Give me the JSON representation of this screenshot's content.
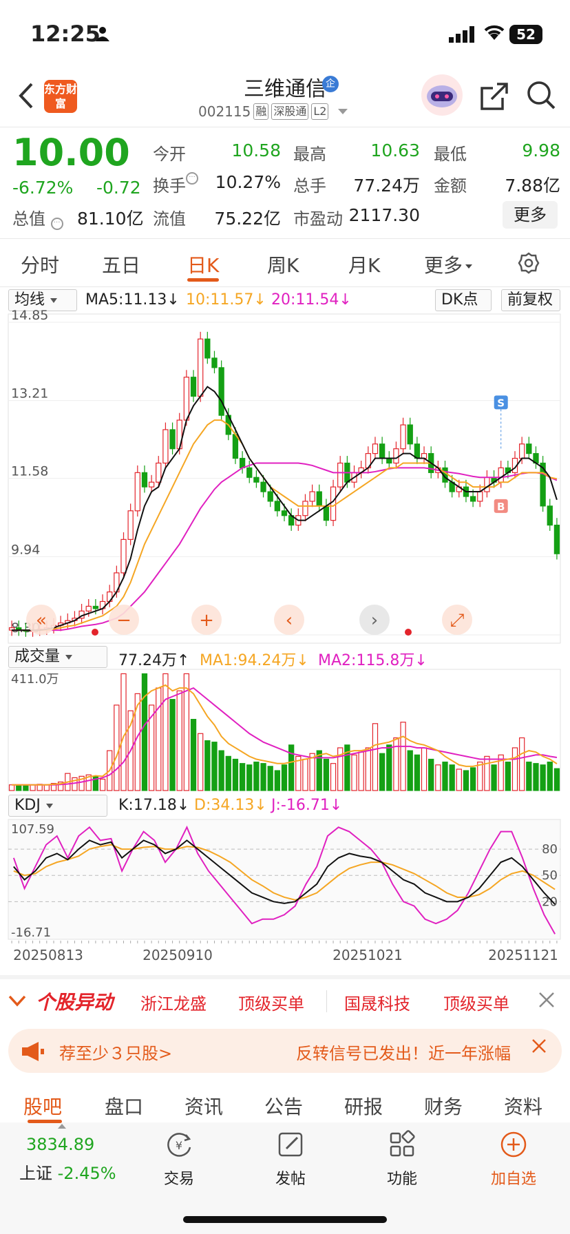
{
  "status": {
    "time": "12:25",
    "battery": "52"
  },
  "header": {
    "logo": "东方财富",
    "name": "三维通信",
    "badge": "企",
    "code": "002115",
    "tags": [
      "融",
      "深股通",
      "L2"
    ]
  },
  "quote": {
    "price": "10.00",
    "pct": "-6.72%",
    "chg": "-0.72",
    "cap_label": "总值",
    "cap_value": "81.10亿",
    "fields": [
      {
        "label": "今开",
        "value": "10.58",
        "color": "green"
      },
      {
        "label": "最高",
        "value": "10.63",
        "color": "green"
      },
      {
        "label": "最低",
        "value": "9.98",
        "color": "green"
      },
      {
        "label": "换手",
        "value": "10.27%",
        "color": "plain"
      },
      {
        "label": "总手",
        "value": "77.24万",
        "color": "plain"
      },
      {
        "label": "金额",
        "value": "7.88亿",
        "color": "plain"
      },
      {
        "label": "流值",
        "value": "75.22亿",
        "color": "plain"
      },
      {
        "label": "市盈动",
        "value": "2117.30",
        "color": "plain"
      }
    ],
    "more": "更多"
  },
  "ktabs": [
    "分时",
    "五日",
    "日K",
    "周K",
    "月K",
    "更多"
  ],
  "chart_legend": {
    "ma_selector": "均线",
    "ma5": "MA5:11.13↓",
    "ma10": "10:11.57↓",
    "ma20": "20:11.54↓",
    "dk": "DK点",
    "fq": "前复权",
    "vol_selector": "成交量",
    "vol": "77.24万↑",
    "vol_ma1": "MA1:94.24万↓",
    "vol_ma2": "MA2:115.8万↓",
    "kdj_selector": "KDJ",
    "k": "K:17.18↓",
    "d": "D:34.13↓",
    "j": "J:-16.71↓"
  },
  "chart_data": {
    "type": "candlestick",
    "y_ticks": [
      "14.85",
      "13.21",
      "11.58",
      "9.94",
      "8.30"
    ],
    "ylim": [
      8.3,
      14.85
    ],
    "vol_max_label": "411.0万",
    "kdj_ticks": {
      "top": "107.59",
      "bottom": "-16.71",
      "levels": [
        "80",
        "50",
        "20"
      ]
    },
    "x_ticks": [
      "20250813",
      "20250910",
      "20251021",
      "20251121"
    ],
    "signals": [
      "S",
      "B"
    ],
    "colors": {
      "up": "#e3242b",
      "down": "#14a014",
      "ma5": "#111111",
      "ma10": "#f5a623",
      "ma20": "#e020c0",
      "k": "#111111",
      "d": "#f5a623",
      "j": "#e020c0"
    },
    "close": [
      8.45,
      8.4,
      8.38,
      8.4,
      8.42,
      8.45,
      8.5,
      8.55,
      8.6,
      8.65,
      8.8,
      8.9,
      8.85,
      9.0,
      9.2,
      9.6,
      10.3,
      10.9,
      11.7,
      11.4,
      11.5,
      11.9,
      12.6,
      12.2,
      12.8,
      13.7,
      13.3,
      14.5,
      14.1,
      13.9,
      12.9,
      12.5,
      12.0,
      11.8,
      11.6,
      11.5,
      11.3,
      11.1,
      10.9,
      10.8,
      10.6,
      10.8,
      11.1,
      11.3,
      11.0,
      10.7,
      11.4,
      11.9,
      11.5,
      11.7,
      11.8,
      12.1,
      12.3,
      12.0,
      11.9,
      12.2,
      12.7,
      12.3,
      12.0,
      12.1,
      11.7,
      11.8,
      11.5,
      11.3,
      11.4,
      11.2,
      11.1,
      11.3,
      11.6,
      11.5,
      11.8,
      11.7,
      12.0,
      12.3,
      12.1,
      11.9,
      11.0,
      10.6,
      10.0
    ],
    "open": [
      8.4,
      8.45,
      8.4,
      8.38,
      8.4,
      8.42,
      8.45,
      8.5,
      8.55,
      8.6,
      8.65,
      8.8,
      8.9,
      8.85,
      9.0,
      9.2,
      9.6,
      10.3,
      10.9,
      11.7,
      11.4,
      11.5,
      11.9,
      12.6,
      12.2,
      12.8,
      13.7,
      13.3,
      14.5,
      14.1,
      13.9,
      12.9,
      12.5,
      12.0,
      11.8,
      11.6,
      11.5,
      11.3,
      11.1,
      10.9,
      10.8,
      10.6,
      10.8,
      11.1,
      11.3,
      11.0,
      10.7,
      11.4,
      11.9,
      11.5,
      11.7,
      11.8,
      12.1,
      12.3,
      12.0,
      11.9,
      12.2,
      12.7,
      12.3,
      12.0,
      12.1,
      11.7,
      11.8,
      11.5,
      11.3,
      11.4,
      11.2,
      11.1,
      11.3,
      11.6,
      11.5,
      11.8,
      11.7,
      12.0,
      12.3,
      12.1,
      11.9,
      11.0,
      10.6
    ],
    "volume": [
      20,
      20,
      18,
      20,
      22,
      20,
      25,
      30,
      60,
      45,
      50,
      55,
      50,
      40,
      140,
      300,
      410,
      280,
      340,
      410,
      300,
      360,
      410,
      320,
      350,
      410,
      250,
      200,
      175,
      170,
      140,
      120,
      110,
      95,
      90,
      100,
      95,
      85,
      70,
      90,
      160,
      120,
      110,
      130,
      140,
      110,
      95,
      150,
      160,
      125,
      135,
      150,
      235,
      130,
      160,
      185,
      240,
      140,
      125,
      150,
      110,
      90,
      100,
      90,
      75,
      70,
      80,
      100,
      120,
      90,
      125,
      100,
      150,
      185,
      100,
      95,
      90,
      100,
      77
    ],
    "ma5": [
      8.4,
      8.4,
      8.4,
      8.4,
      8.4,
      8.42,
      8.45,
      8.5,
      8.55,
      8.6,
      8.7,
      8.75,
      8.8,
      8.85,
      9.0,
      9.2,
      9.5,
      9.9,
      10.5,
      11.0,
      11.3,
      11.4,
      11.8,
      12.0,
      12.2,
      12.8,
      13.1,
      13.3,
      13.5,
      13.4,
      13.2,
      12.9,
      12.6,
      12.3,
      12.0,
      11.8,
      11.6,
      11.4,
      11.2,
      11.0,
      10.8,
      10.7,
      10.7,
      10.8,
      10.9,
      11.0,
      11.1,
      11.3,
      11.5,
      11.6,
      11.7,
      11.8,
      12.0,
      12.0,
      12.0,
      12.0,
      12.1,
      12.1,
      12.0,
      12.0,
      11.9,
      11.8,
      11.6,
      11.5,
      11.4,
      11.3,
      11.3,
      11.3,
      11.4,
      11.5,
      11.6,
      11.7,
      11.8,
      12.0,
      12.0,
      11.9,
      11.8,
      11.6,
      11.13
    ],
    "ma10": [
      8.4,
      8.4,
      8.4,
      8.4,
      8.4,
      8.4,
      8.42,
      8.45,
      8.48,
      8.5,
      8.55,
      8.6,
      8.65,
      8.7,
      8.8,
      8.9,
      9.1,
      9.4,
      9.8,
      10.2,
      10.5,
      10.8,
      11.1,
      11.4,
      11.7,
      12.0,
      12.3,
      12.5,
      12.7,
      12.8,
      12.8,
      12.7,
      12.5,
      12.3,
      12.0,
      11.8,
      11.6,
      11.4,
      11.3,
      11.2,
      11.1,
      11.0,
      11.0,
      11.0,
      11.0,
      11.0,
      11.0,
      11.1,
      11.2,
      11.3,
      11.4,
      11.5,
      11.6,
      11.7,
      11.8,
      11.8,
      11.9,
      11.9,
      11.9,
      11.9,
      11.9,
      11.8,
      11.7,
      11.6,
      11.5,
      11.5,
      11.4,
      11.4,
      11.4,
      11.4,
      11.5,
      11.5,
      11.6,
      11.7,
      11.7,
      11.7,
      11.7,
      11.6,
      11.57
    ],
    "ma20": [
      8.4,
      8.4,
      8.4,
      8.4,
      8.4,
      8.4,
      8.4,
      8.4,
      8.42,
      8.45,
      8.48,
      8.5,
      8.52,
      8.55,
      8.6,
      8.65,
      8.75,
      8.9,
      9.05,
      9.2,
      9.4,
      9.6,
      9.8,
      10.0,
      10.2,
      10.45,
      10.7,
      10.95,
      11.15,
      11.35,
      11.5,
      11.6,
      11.7,
      11.8,
      11.85,
      11.9,
      11.9,
      11.9,
      11.9,
      11.9,
      11.9,
      11.9,
      11.88,
      11.85,
      11.8,
      11.75,
      11.7,
      11.7,
      11.7,
      11.7,
      11.7,
      11.7,
      11.72,
      11.75,
      11.78,
      11.8,
      11.8,
      11.8,
      11.8,
      11.8,
      11.78,
      11.75,
      11.72,
      11.7,
      11.68,
      11.65,
      11.62,
      11.6,
      11.6,
      11.6,
      11.6,
      11.62,
      11.65,
      11.68,
      11.7,
      11.7,
      11.68,
      11.6,
      11.54
    ],
    "vol_ma1": [
      20,
      20,
      20,
      20,
      20,
      20,
      22,
      24,
      30,
      35,
      40,
      48,
      52,
      50,
      70,
      120,
      190,
      230,
      300,
      330,
      350,
      360,
      370,
      350,
      360,
      360,
      340,
      300,
      260,
      230,
      190,
      165,
      150,
      135,
      120,
      110,
      105,
      100,
      95,
      95,
      100,
      105,
      110,
      115,
      125,
      130,
      120,
      125,
      135,
      140,
      140,
      145,
      160,
      165,
      170,
      180,
      190,
      175,
      165,
      160,
      150,
      140,
      120,
      105,
      90,
      85,
      85,
      90,
      95,
      100,
      105,
      110,
      115,
      130,
      140,
      135,
      120,
      110,
      94
    ],
    "vol_ma2": [
      20,
      20,
      20,
      20,
      20,
      20,
      20,
      21,
      23,
      26,
      30,
      35,
      40,
      45,
      55,
      75,
      100,
      140,
      190,
      230,
      260,
      290,
      320,
      330,
      340,
      350,
      360,
      340,
      320,
      300,
      280,
      260,
      240,
      220,
      200,
      185,
      170,
      160,
      150,
      140,
      130,
      125,
      120,
      115,
      115,
      115,
      115,
      120,
      125,
      130,
      135,
      140,
      145,
      150,
      150,
      155,
      155,
      155,
      150,
      150,
      145,
      140,
      135,
      130,
      125,
      120,
      115,
      110,
      110,
      110,
      110,
      110,
      110,
      115,
      120,
      125,
      125,
      120,
      116
    ],
    "k": [
      60,
      45,
      55,
      70,
      75,
      68,
      80,
      90,
      85,
      88,
      70,
      80,
      90,
      85,
      75,
      80,
      90,
      80,
      70,
      60,
      50,
      40,
      30,
      25,
      20,
      18,
      20,
      30,
      40,
      60,
      70,
      75,
      72,
      70,
      65,
      55,
      45,
      40,
      30,
      25,
      20,
      20,
      25,
      35,
      50,
      65,
      70,
      60,
      45,
      30,
      17
    ],
    "d": [
      55,
      50,
      52,
      60,
      65,
      68,
      72,
      80,
      83,
      85,
      80,
      80,
      82,
      83,
      80,
      80,
      83,
      82,
      78,
      72,
      65,
      55,
      45,
      38,
      30,
      25,
      22,
      25,
      30,
      40,
      50,
      58,
      62,
      65,
      65,
      62,
      57,
      52,
      45,
      38,
      30,
      25,
      25,
      28,
      35,
      45,
      52,
      55,
      50,
      42,
      34
    ],
    "j": [
      70,
      35,
      60,
      85,
      95,
      70,
      95,
      105,
      90,
      92,
      55,
      80,
      100,
      90,
      65,
      80,
      105,
      75,
      55,
      40,
      25,
      10,
      -5,
      0,
      0,
      5,
      15,
      40,
      60,
      95,
      105,
      100,
      90,
      80,
      65,
      40,
      20,
      15,
      0,
      -5,
      0,
      10,
      30,
      55,
      80,
      100,
      100,
      70,
      35,
      5,
      -17
    ]
  },
  "movers": {
    "title": "个股异动",
    "items": [
      "浙江龙盛",
      "顶级买单",
      "国晟科技",
      "顶级买单"
    ]
  },
  "promo": {
    "left": "荐至少３只股>",
    "right": "反转信号已发出！近一年涨幅"
  },
  "content_tabs": [
    "股吧",
    "盘口",
    "资讯",
    "公告",
    "研报",
    "财务",
    "资料"
  ],
  "bottom_nav": {
    "index_value": "3834.89",
    "index_label": "上证",
    "index_pct": "-2.45%",
    "items": [
      "交易",
      "发帖",
      "功能",
      "加自选"
    ]
  }
}
